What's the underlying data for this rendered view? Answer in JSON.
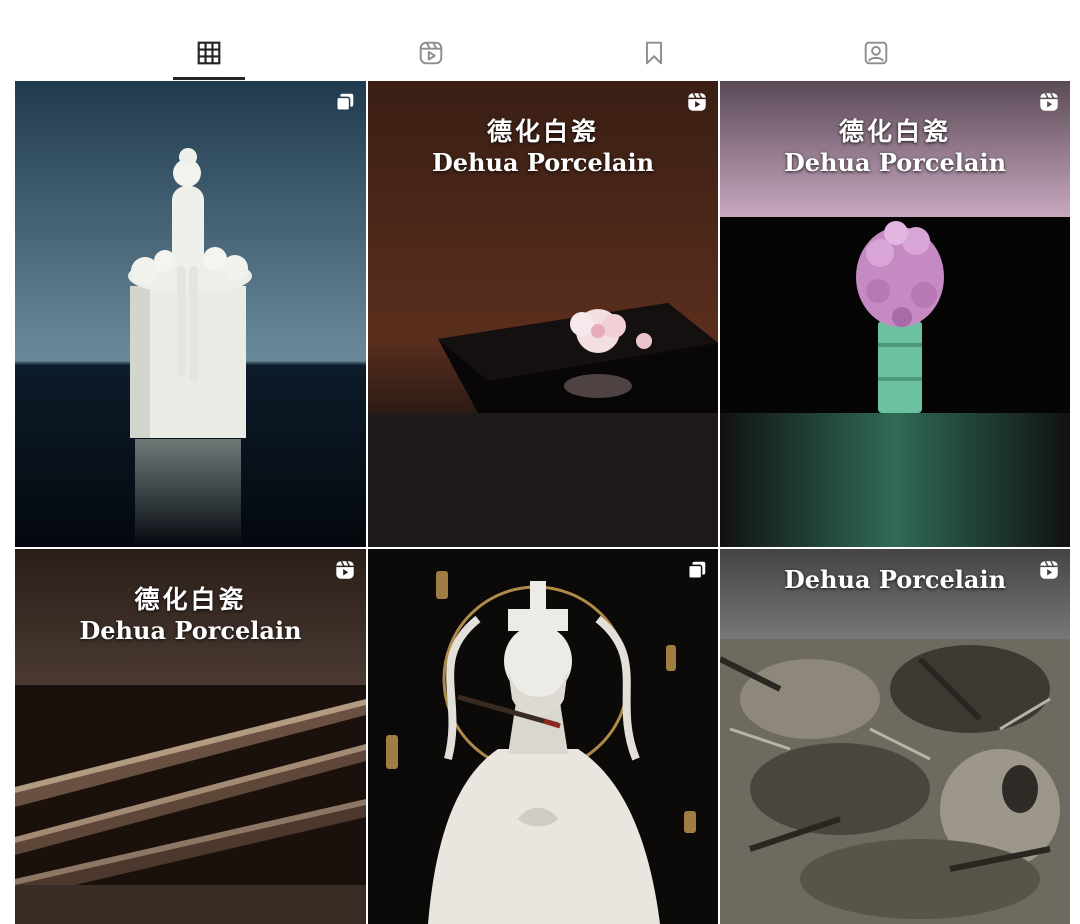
{
  "tabs": [
    {
      "name": "posts",
      "icon": "grid-icon",
      "active": true
    },
    {
      "name": "reels",
      "icon": "reels-icon",
      "active": false
    },
    {
      "name": "saved",
      "icon": "bookmark-icon",
      "active": false
    },
    {
      "name": "tagged",
      "icon": "tagged-person-icon",
      "active": false
    }
  ],
  "posts": [
    {
      "badge": "carousel-icon"
    },
    {
      "badge": "reels-icon",
      "caption_zh": "德化白瓷",
      "caption_en": "Dehua Porcelain"
    },
    {
      "badge": "reels-icon",
      "caption_zh": "德化白瓷",
      "caption_en": "Dehua Porcelain"
    },
    {
      "badge": "reels-icon",
      "caption_zh": "德化白瓷",
      "caption_en": "Dehua Porcelain"
    },
    {
      "badge": "carousel-icon"
    },
    {
      "badge": "reels-icon",
      "caption_en": "Dehua Porcelain"
    }
  ],
  "colors": {
    "tab_active": "#262626",
    "tab_inactive": "#8e8e8e",
    "caption": "#ffffff"
  }
}
